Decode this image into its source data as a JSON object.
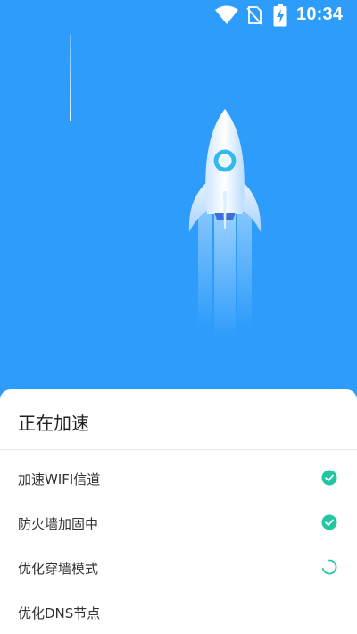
{
  "status_bar": {
    "time": "10:34",
    "icons": [
      "wifi-icon",
      "no-sim-icon",
      "battery-charging-icon"
    ]
  },
  "hero": {
    "illustration": "rocket-icon"
  },
  "sheet": {
    "title": "正在加速",
    "tasks": [
      {
        "label": "加速WIFI信道",
        "status": "done"
      },
      {
        "label": "防火墙加固中",
        "status": "done"
      },
      {
        "label": "优化穿墙模式",
        "status": "loading"
      },
      {
        "label": "优化DNS节点",
        "status": "pending"
      }
    ]
  },
  "colors": {
    "background": "#2d9cfb",
    "sheet": "#ffffff",
    "check": "#21c7a0",
    "text_primary": "#222222"
  }
}
